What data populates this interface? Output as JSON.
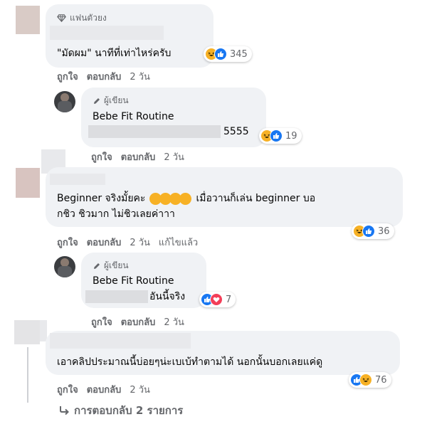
{
  "comment1": {
    "badge": "แฟนตัวยง",
    "text": "\"มัดผม\" นาทีที่เท่าไหร่ครับ",
    "reaction_count": "345",
    "actions": {
      "like": "ถูกใจ",
      "reply": "ตอบกลับ",
      "time": "2 วัน"
    }
  },
  "reply1": {
    "author_badge": "ผู้เขียน",
    "author": "Bebe Fit Routine",
    "text": "5555",
    "reaction_count": "19",
    "actions": {
      "like": "ถูกใจ",
      "reply": "ตอบกลับ",
      "time": "2 วัน"
    }
  },
  "comment2": {
    "text_line1_a": "Beginner จริงมั้ยคะ",
    "text_line1_b": "เมื่อวานก็เล่น beginner บอ",
    "text_line2": "กชิว ชิวมาก ไม่ชิวเลยค่าาา",
    "reaction_count": "36",
    "actions": {
      "like": "ถูกใจ",
      "reply": "ตอบกลับ",
      "time": "2 วัน",
      "edited": "แก้ไขแล้ว"
    }
  },
  "reply2": {
    "author_badge": "ผู้เขียน",
    "author": "Bebe Fit Routine",
    "text": "อันนี้จริง",
    "reaction_count": "7",
    "actions": {
      "like": "ถูกใจ",
      "reply": "ตอบกลับ",
      "time": "2 วัน"
    }
  },
  "comment3": {
    "text": "เอาคลิปประมาณนี้บ่อยๆน่ะเบเบ้ทำตามได้ นอกนั้นบอกเลยแค่ดู",
    "reaction_count": "76",
    "actions": {
      "like": "ถูกใจ",
      "reply": "ตอบกลับ",
      "time": "2 วัน"
    }
  },
  "view_replies": "การตอบกลับ 2 รายการ",
  "icons": {
    "fan": "diamond-icon",
    "author": "pencil-icon",
    "like": "like-icon",
    "haha": "haha-icon",
    "love": "love-icon",
    "replies": "reply-arrow-icon"
  },
  "colors": {
    "bubble": "#f0f2f5",
    "meta_text": "#65676b",
    "like": "#1877f2",
    "haha": "#f7b125",
    "love": "#f33e58"
  }
}
